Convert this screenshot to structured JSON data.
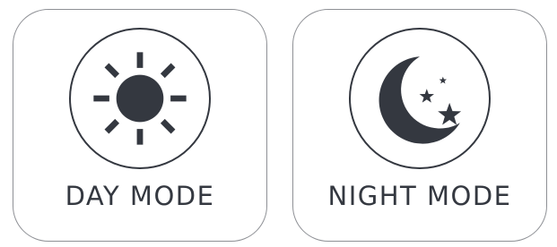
{
  "colors": {
    "icon": "#343840",
    "tile_border": "#8e9095",
    "background": "#ffffff"
  },
  "tiles": [
    {
      "label": "DAY MODE",
      "icon": "sun-icon"
    },
    {
      "label": "NIGHT MODE",
      "icon": "moon-stars-icon"
    }
  ]
}
